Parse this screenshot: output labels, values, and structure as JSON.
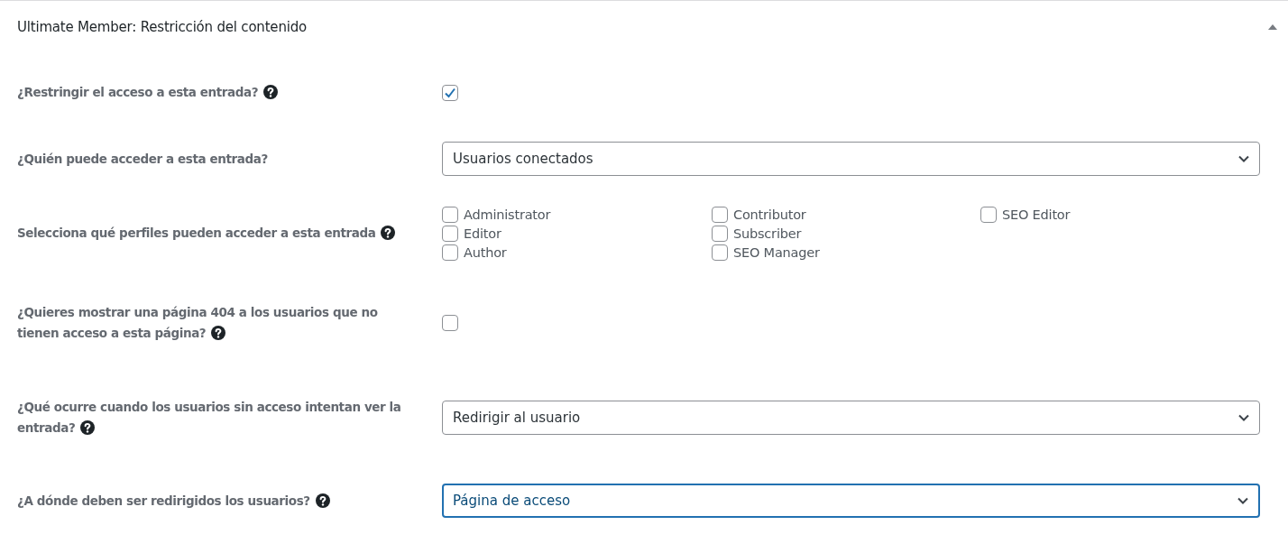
{
  "panel": {
    "title": "Ultimate Member: Restricción del contenido",
    "expanded": true
  },
  "fields": [
    {
      "kind": "checkbox",
      "label": "¿Restringir el acceso a esta entrada?",
      "help": true,
      "checked": true
    },
    {
      "kind": "select",
      "label": "¿Quién puede acceder a esta entrada?",
      "help": false,
      "value": "Usuarios conectados",
      "focused": false
    },
    {
      "kind": "roles",
      "label": "Selecciona qué perfiles pueden acceder a esta entrada",
      "help": true,
      "options": [
        {
          "label": "Administrator",
          "checked": false
        },
        {
          "label": "Editor",
          "checked": false
        },
        {
          "label": "Author",
          "checked": false
        },
        {
          "label": "Contributor",
          "checked": false
        },
        {
          "label": "Subscriber",
          "checked": false
        },
        {
          "label": "SEO Manager",
          "checked": false
        },
        {
          "label": "SEO Editor",
          "checked": false
        }
      ]
    },
    {
      "kind": "checkbox",
      "label": "¿Quieres mostrar una página 404 a los usuarios que no tienen acceso a esta página?",
      "help": true,
      "checked": false
    },
    {
      "kind": "select",
      "label": "¿Qué ocurre cuando los usuarios sin acceso intentan ver la entrada?",
      "help": true,
      "value": "Redirigir al usuario",
      "focused": false
    },
    {
      "kind": "select",
      "label": "¿A dónde deben ser redirigidos los usuarios?",
      "help": true,
      "value": "Página de acceso",
      "focused": true
    }
  ]
}
